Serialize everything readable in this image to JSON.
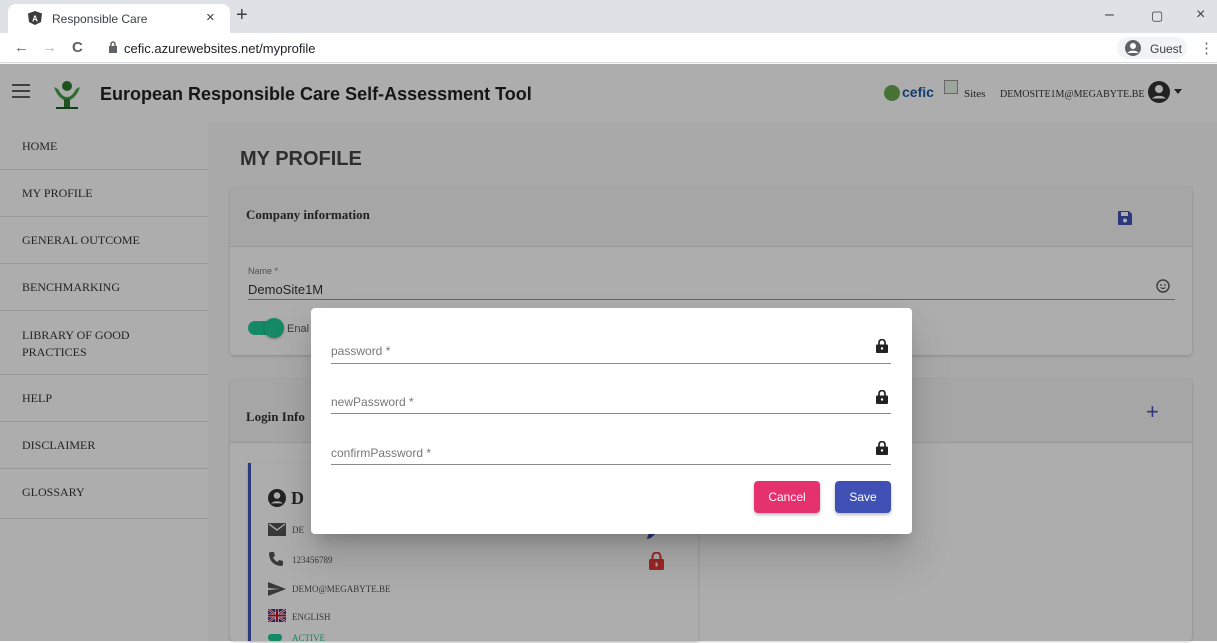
{
  "browser": {
    "tab_title": "Responsible Care",
    "tab_close": "×",
    "new_tab": "+",
    "url": "cefic.azurewebsites.net/myprofile",
    "profile_label": "Guest",
    "win_min": "–",
    "win_max": "▢",
    "win_close": "×",
    "menu": "⋮",
    "back": "←",
    "forward": "→",
    "reload": "C"
  },
  "appbar": {
    "title": "European Responsible Care Self-Assessment Tool",
    "cefic_logo_text": "cefic",
    "sites_label": "Sites",
    "user_email": "DEMOSITE1M@MEGABYTE.BE"
  },
  "sidebar": {
    "items": [
      {
        "label": "HOME"
      },
      {
        "label": "MY PROFILE"
      },
      {
        "label": "GENERAL OUTCOME"
      },
      {
        "label": "BENCHMARKING"
      },
      {
        "label": "LIBRARY OF GOOD"
      },
      {
        "label": "PRACTICES"
      },
      {
        "label": "HELP"
      },
      {
        "label": "DISCLAIMER"
      },
      {
        "label": "GLOSSARY"
      }
    ]
  },
  "main": {
    "page_title": "MY PROFILE",
    "company_card": {
      "title": "Company information",
      "name_label": "Name *",
      "name_value": "DemoSite1M",
      "enabled_label": "Enal"
    },
    "login_card": {
      "title": "Login Info",
      "add_label": "+"
    },
    "user_card": {
      "name_initial": "D",
      "email_partial": "DE",
      "phone": "123456789",
      "email": "DEMO@MEGABYTE.BE",
      "language": "ENGLISH",
      "status": "ACTIVE"
    }
  },
  "dialog": {
    "fields": [
      {
        "label": "password *"
      },
      {
        "label": "newPassword *"
      },
      {
        "label": "confirmPassword *"
      }
    ],
    "cancel_label": "Cancel",
    "save_label": "Save",
    "cancel_color": "#e5316e",
    "save_color": "#3f51b5"
  }
}
